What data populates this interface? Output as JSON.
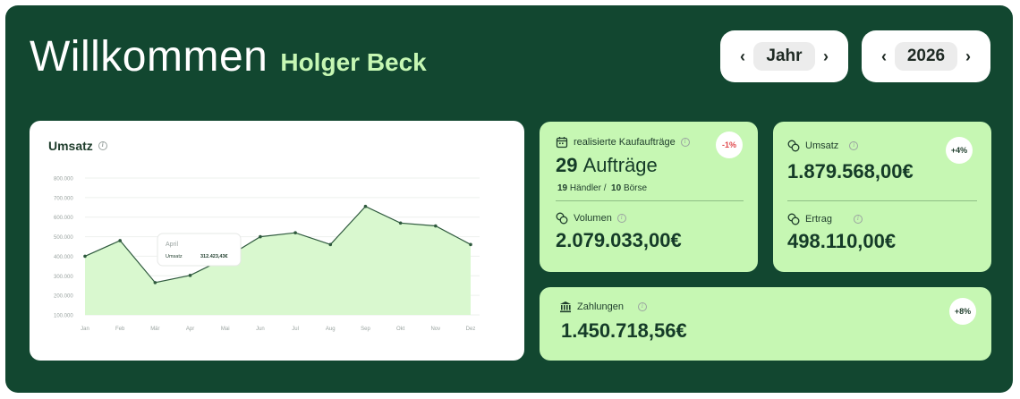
{
  "welcome": {
    "title": "Willkommen",
    "name": "Holger Beck"
  },
  "period_picker": {
    "value": "Jahr",
    "prev": "‹",
    "next": "›"
  },
  "year_picker": {
    "value": "2026",
    "prev": "‹",
    "next": "›"
  },
  "revenue_chart": {
    "title": "Umsatz",
    "tooltip": {
      "month": "April",
      "label": "Umsatz",
      "value": "312.423,43€"
    }
  },
  "chart_data": {
    "type": "area",
    "categories": [
      "Jan",
      "Feb",
      "Mär",
      "Apr",
      "Mai",
      "Jun",
      "Jul",
      "Aug",
      "Sep",
      "Okt",
      "Nov",
      "Dez"
    ],
    "values": [
      400000,
      480000,
      265000,
      302000,
      390000,
      500000,
      520000,
      460000,
      655000,
      570000,
      555000,
      460000
    ],
    "ylim": [
      100000,
      800000
    ],
    "yticks": [
      "100.000",
      "200.000",
      "300.000",
      "400.000",
      "500.000",
      "600.000",
      "700.000",
      "800.000"
    ],
    "title": "Umsatz",
    "grid": true
  },
  "kpi_orders": {
    "label": "realisierte Kaufaufträge",
    "count": "29",
    "unit": "Aufträge",
    "dealers_count": "19",
    "dealers_label": "Händler /",
    "exchange_count": "10",
    "exchange_label": "Börse",
    "badge": "-1%",
    "volume_label": "Volumen",
    "volume_value": "2.079.033,00€"
  },
  "kpi_revenue": {
    "label": "Umsatz",
    "value": "1.879.568,00€",
    "badge": "+4%",
    "yield_label": "Ertrag",
    "yield_value": "498.110,00€"
  },
  "kpi_payments": {
    "label": "Zahlungen",
    "value": "1.450.718,56€",
    "badge": "+8%"
  },
  "colors": {
    "background": "#124730",
    "card_green": "#c6f7b3",
    "accent_name": "#c6f7b3",
    "line": "#2f5a3e",
    "area": "#d9f8cf",
    "badge_negative": "#e0474c",
    "badge_positive": "#1f3d2c"
  }
}
